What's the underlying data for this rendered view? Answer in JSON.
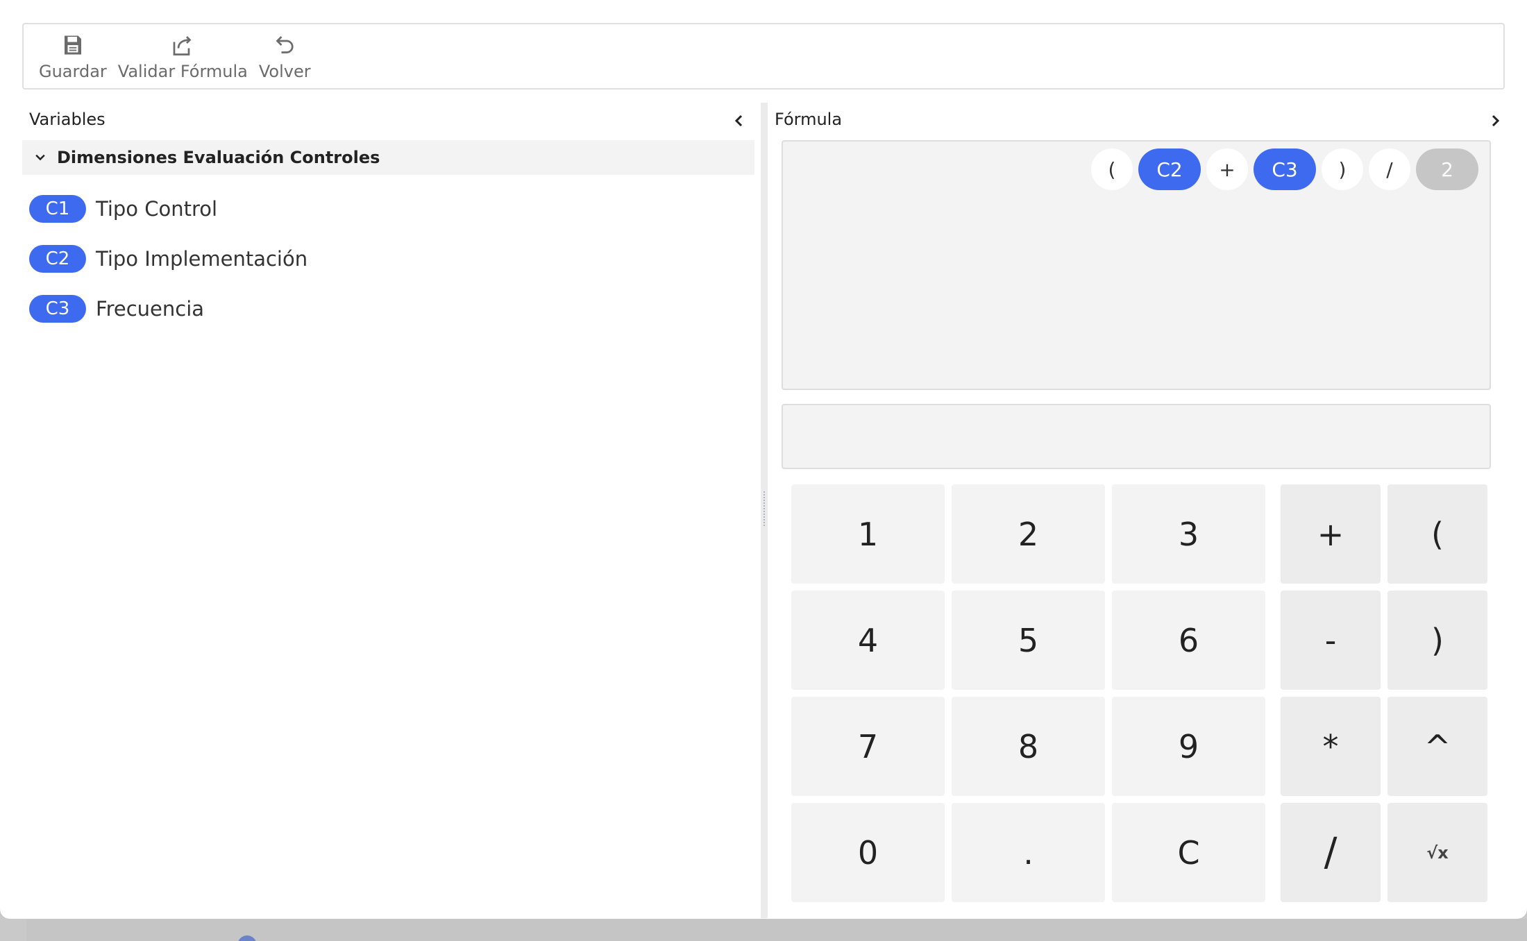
{
  "toolbar": {
    "save_label": "Guardar",
    "validate_label": "Validar Fórmula",
    "back_label": "Volver"
  },
  "variables_panel": {
    "title": "Variables",
    "group_title": "Dimensiones Evaluación Controles",
    "items": [
      {
        "code": "C1",
        "label": "Tipo Control"
      },
      {
        "code": "C2",
        "label": "Tipo Implementación"
      },
      {
        "code": "C3",
        "label": "Frecuencia"
      }
    ]
  },
  "formula_panel": {
    "title": "Fórmula",
    "tokens": [
      "(",
      "C2",
      "+",
      "C3",
      ")",
      "/",
      "2"
    ],
    "result": ""
  },
  "keypad": {
    "digits": [
      "1",
      "2",
      "3",
      "4",
      "5",
      "6",
      "7",
      "8",
      "9",
      "0",
      ".",
      "C"
    ],
    "ops": [
      "+",
      "(",
      "-",
      ")",
      "*",
      "^",
      "/",
      "√x"
    ]
  },
  "colors": {
    "accent": "#3e6af0",
    "number_token": "#c6c6c6",
    "key_bg": "#f3f3f3"
  }
}
